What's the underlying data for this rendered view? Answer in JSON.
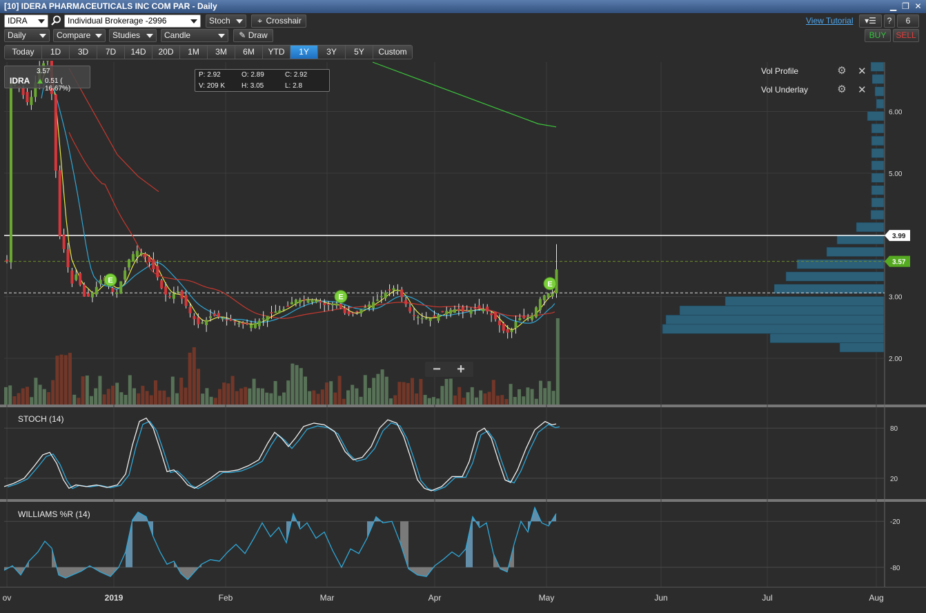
{
  "window": {
    "title": "[10] IDERA PHARMACEUTICALS INC COM PAR - Daily",
    "controls": [
      "▁",
      "❐",
      "✕"
    ]
  },
  "toolbar": {
    "symbol": "IDRA",
    "account": "Individual Brokerage -2996",
    "indicator": "Stoch",
    "crosshair_label": "Crosshair",
    "view_tutorial": "View Tutorial",
    "help_label": "?",
    "count_label": "6",
    "buy_label": "BUY",
    "sell_label": "SELL"
  },
  "toolbar2": {
    "interval": "Daily",
    "compare": "Compare",
    "studies": "Studies",
    "chart_type": "Candle",
    "draw_label": "Draw"
  },
  "range_buttons": [
    "Today",
    "1D",
    "3D",
    "7D",
    "14D",
    "20D",
    "1M",
    "3M",
    "6M",
    "YTD",
    "1Y",
    "3Y",
    "5Y",
    "Custom"
  ],
  "range_active": "1Y",
  "ticker_overlay": {
    "symbol": "IDRA",
    "last": "3.57",
    "change": "0.51 ( 16.67%)"
  },
  "ohlc_box": {
    "p": "P: 2.92",
    "o": "O: 2.89",
    "c": "C: 2.92",
    "v": "V: 209 K",
    "h": "H: 3.05",
    "l": "L: 2.8"
  },
  "studies": [
    {
      "label": "Vol Profile"
    },
    {
      "label": "Vol Underlay"
    }
  ],
  "zoom": {
    "minus": "−",
    "plus": "+"
  },
  "panels": {
    "stoch_label": "STOCH (14)",
    "williams_label": "WILLIAMS %R (14)"
  },
  "chart_data": {
    "type": "candlestick",
    "price_axis_ticks": [
      "6.00",
      "5.00",
      "4.00",
      "3.00",
      "2.00"
    ],
    "price_ylim": [
      1.25,
      6.8
    ],
    "price_tags": [
      {
        "label": "3.99",
        "value": 3.99,
        "color": "#ffffff"
      },
      {
        "label": "3.57",
        "value": 3.57,
        "color": "#55aa22"
      }
    ],
    "reference_lines": [
      {
        "value": 3.99,
        "style": "solid",
        "color": "#ffffff"
      },
      {
        "value": 3.57,
        "style": "dashed",
        "color": "#6f8f2a"
      },
      {
        "value": 3.06,
        "style": "dashed",
        "color": "#dddddd"
      }
    ],
    "x_ticks": [
      "ov",
      "2019",
      "Feb",
      "Mar",
      "Apr",
      "May",
      "Jun",
      "Jul",
      "Aug"
    ],
    "earnings_markers": [
      {
        "label": "E",
        "date": "2019-01-01",
        "price": 3.27
      },
      {
        "label": "E",
        "date": "2019-03-07",
        "price": 3.0
      },
      {
        "label": "E",
        "date": "2019-05-01",
        "price": 3.21
      }
    ],
    "moving_average_colors": [
      "#e8e84a",
      "#2fa8d8",
      "#c8382f",
      "#3cc83c"
    ],
    "stoch_ticks": [
      "80",
      "20"
    ],
    "williams_ticks": [
      "-20",
      "-80"
    ],
    "stoch_ylim": [
      0,
      100
    ],
    "williams_ylim": [
      -100,
      0
    ]
  }
}
